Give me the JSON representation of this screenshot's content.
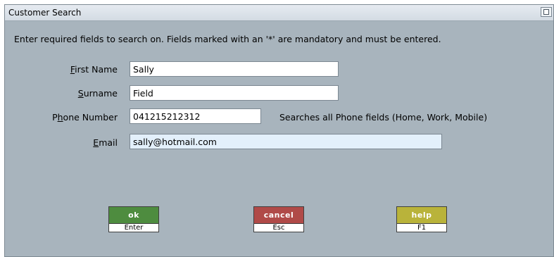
{
  "window": {
    "title": "Customer Search",
    "instruction": "Enter required fields to search on.  Fields marked with an '*' are mandatory and must be entered."
  },
  "form": {
    "first_name": {
      "label_accel": "F",
      "label_rest": "irst Name",
      "value": "Sally"
    },
    "surname": {
      "label_accel": "S",
      "label_rest": "urname",
      "value": "Field"
    },
    "phone": {
      "label_pre": "P",
      "label_accel": "h",
      "label_rest": "one Number",
      "value": "041215212312",
      "hint": "Searches all Phone fields (Home, Work, Mobile)"
    },
    "email": {
      "label_accel": "E",
      "label_rest": "mail",
      "value": "sally@hotmail.com"
    }
  },
  "buttons": {
    "ok": {
      "label": "ok",
      "shortcut": "Enter",
      "color": "#4e8c3f"
    },
    "cancel": {
      "label": "cancel",
      "shortcut": "Esc",
      "color": "#b04a48"
    },
    "help": {
      "label": "help",
      "shortcut": "F1",
      "color": "#b9b33a"
    }
  },
  "icons": {
    "window_button": "restore-window-icon"
  }
}
